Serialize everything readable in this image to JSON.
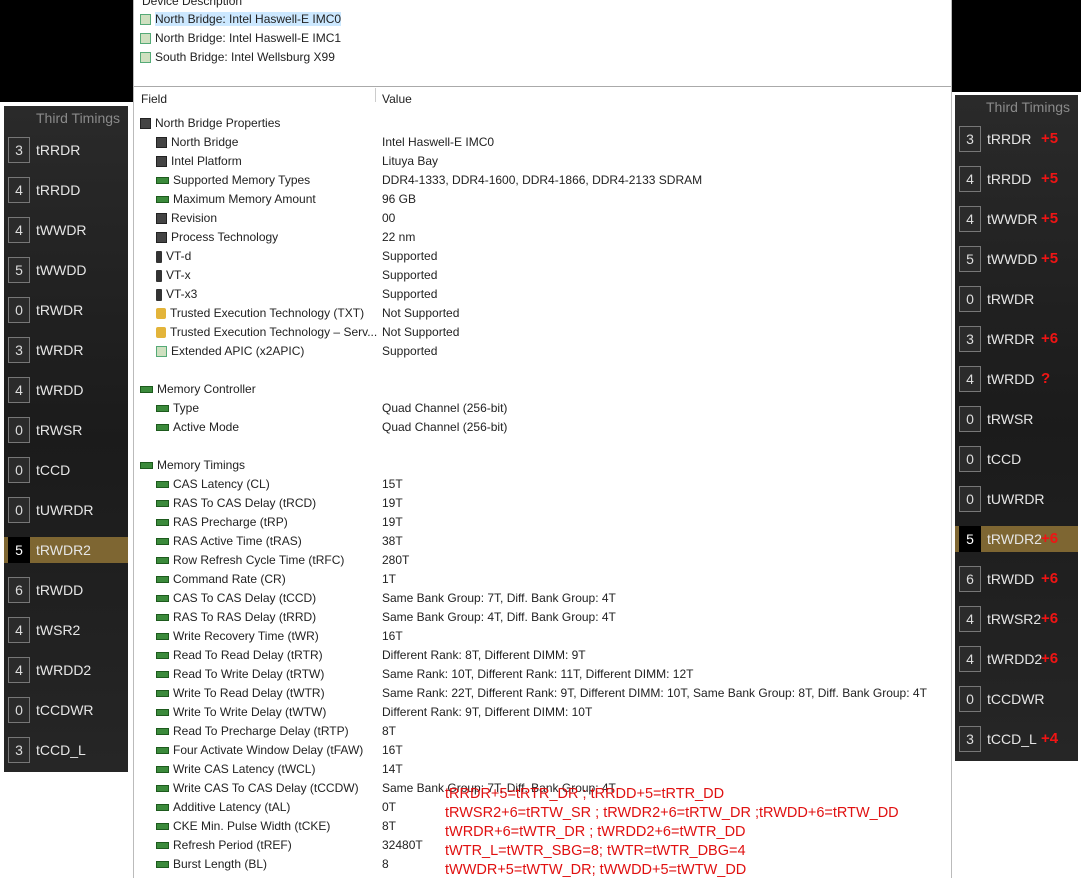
{
  "device_panel": {
    "header": "Device Description",
    "devices": [
      {
        "label": "North Bridge: Intel Haswell-E IMC0",
        "icon": "chip-icon",
        "selected": true
      },
      {
        "label": "North Bridge: Intel Haswell-E IMC1",
        "icon": "chip-icon",
        "selected": false
      },
      {
        "label": "South Bridge: Intel Wellsburg X99",
        "icon": "chip-icon",
        "selected": false
      }
    ]
  },
  "columns": {
    "field": "Field",
    "value": "Value"
  },
  "properties": [
    {
      "field": "North Bridge Properties",
      "value": "",
      "group": true,
      "icon": "chip-icon"
    },
    {
      "field": "North Bridge",
      "value": "Intel Haswell-E IMC0",
      "icon": "chip-icon"
    },
    {
      "field": "Intel Platform",
      "value": "Lituya Bay",
      "icon": "chip-icon"
    },
    {
      "field": "Supported Memory Types",
      "value": "DDR4-1333, DDR4-1600, DDR4-1866, DDR4-2133 SDRAM",
      "icon": "memory-icon"
    },
    {
      "field": "Maximum Memory Amount",
      "value": "96 GB",
      "icon": "memory-icon"
    },
    {
      "field": "Revision",
      "value": "00",
      "icon": "chip-icon"
    },
    {
      "field": "Process Technology",
      "value": "22 nm",
      "icon": "chip-icon"
    },
    {
      "field": "VT-d",
      "value": "Supported",
      "icon": "device-icon"
    },
    {
      "field": "VT-x",
      "value": "Supported",
      "icon": "device-icon"
    },
    {
      "field": "VT-x3",
      "value": "Supported",
      "icon": "device-icon"
    },
    {
      "field": "Trusted Execution Technology (TXT)",
      "value": "Not Supported",
      "icon": "lock-icon"
    },
    {
      "field": "Trusted Execution Technology – Serv...",
      "value": "Not Supported",
      "icon": "lock-icon"
    },
    {
      "field": "Extended APIC (x2APIC)",
      "value": "Supported",
      "icon": "apic-icon"
    },
    {
      "field": "",
      "value": "",
      "blank": true
    },
    {
      "field": "Memory Controller",
      "value": "",
      "group": true,
      "icon": "memory-icon"
    },
    {
      "field": "Type",
      "value": "Quad Channel  (256-bit)",
      "icon": "memory-icon"
    },
    {
      "field": "Active Mode",
      "value": "Quad Channel  (256-bit)",
      "icon": "memory-icon"
    },
    {
      "field": "",
      "value": "",
      "blank": true
    },
    {
      "field": "Memory Timings",
      "value": "",
      "group": true,
      "icon": "memory-icon"
    },
    {
      "field": "CAS Latency (CL)",
      "value": "15T",
      "icon": "memory-icon"
    },
    {
      "field": "RAS To CAS Delay (tRCD)",
      "value": "19T",
      "icon": "memory-icon"
    },
    {
      "field": "RAS Precharge (tRP)",
      "value": "19T",
      "icon": "memory-icon"
    },
    {
      "field": "RAS Active Time (tRAS)",
      "value": "38T",
      "icon": "memory-icon"
    },
    {
      "field": "Row Refresh Cycle Time (tRFC)",
      "value": "280T",
      "icon": "memory-icon"
    },
    {
      "field": "Command Rate (CR)",
      "value": "1T",
      "icon": "memory-icon"
    },
    {
      "field": "CAS To CAS Delay (tCCD)",
      "value": "Same Bank Group: 7T, Diff. Bank Group: 4T",
      "icon": "memory-icon"
    },
    {
      "field": "RAS To RAS Delay (tRRD)",
      "value": "Same Bank Group: 4T, Diff. Bank Group: 4T",
      "icon": "memory-icon"
    },
    {
      "field": "Write Recovery Time (tWR)",
      "value": "16T",
      "icon": "memory-icon"
    },
    {
      "field": "Read To Read Delay (tRTR)",
      "value": "Different Rank: 8T, Different DIMM: 9T",
      "icon": "memory-icon"
    },
    {
      "field": "Read To Write Delay (tRTW)",
      "value": "Same Rank: 10T, Different Rank: 11T, Different DIMM: 12T",
      "icon": "memory-icon"
    },
    {
      "field": "Write To Read Delay (tWTR)",
      "value": "Same Rank: 22T, Different Rank: 9T, Different DIMM: 10T, Same Bank Group: 8T, Diff. Bank Group: 4T",
      "icon": "memory-icon"
    },
    {
      "field": "Write To Write Delay (tWTW)",
      "value": "Different Rank: 9T, Different DIMM: 10T",
      "icon": "memory-icon"
    },
    {
      "field": "Read To Precharge Delay (tRTP)",
      "value": "8T",
      "icon": "memory-icon"
    },
    {
      "field": "Four Activate Window Delay (tFAW)",
      "value": "16T",
      "icon": "memory-icon"
    },
    {
      "field": "Write CAS Latency (tWCL)",
      "value": "14T",
      "icon": "memory-icon"
    },
    {
      "field": "Write CAS To CAS Delay (tCCDW)",
      "value": "Same Bank Group: 7T, Diff. Bank Group: 4T",
      "icon": "memory-icon"
    },
    {
      "field": "Additive Latency (tAL)",
      "value": "0T",
      "icon": "memory-icon"
    },
    {
      "field": "CKE Min. Pulse Width (tCKE)",
      "value": "8T",
      "icon": "memory-icon"
    },
    {
      "field": "Refresh Period (tREF)",
      "value": "32480T",
      "icon": "memory-icon"
    },
    {
      "field": "Burst Length (BL)",
      "value": "8",
      "icon": "memory-icon"
    }
  ],
  "left_timings": {
    "title": "Third Timings",
    "rows": [
      {
        "num": "3",
        "label": "tRRDR"
      },
      {
        "num": "4",
        "label": "tRRDD"
      },
      {
        "num": "4",
        "label": "tWWDR"
      },
      {
        "num": "5",
        "label": "tWWDD"
      },
      {
        "num": "0",
        "label": "tRWDR"
      },
      {
        "num": "3",
        "label": "tWRDR"
      },
      {
        "num": "4",
        "label": "tWRDD"
      },
      {
        "num": "0",
        "label": "tRWSR"
      },
      {
        "num": "0",
        "label": "tCCD"
      },
      {
        "num": "0",
        "label": "tUWRDR"
      },
      {
        "num": "5",
        "label": "tRWDR2",
        "highlight": true
      },
      {
        "num": "6",
        "label": "tRWDD"
      },
      {
        "num": "4",
        "label": "tWSR2"
      },
      {
        "num": "4",
        "label": "tWRDD2"
      },
      {
        "num": "0",
        "label": "tCCDWR"
      },
      {
        "num": "3",
        "label": "tCCD_L"
      }
    ]
  },
  "right_timings": {
    "title": "Third Timings",
    "rows": [
      {
        "num": "3",
        "label": "tRRDR",
        "delta": "+5"
      },
      {
        "num": "4",
        "label": "tRRDD",
        "delta": "+5"
      },
      {
        "num": "4",
        "label": "tWWDR",
        "delta": "+5"
      },
      {
        "num": "5",
        "label": "tWWDD",
        "delta": "+5"
      },
      {
        "num": "0",
        "label": "tRWDR",
        "delta": ""
      },
      {
        "num": "3",
        "label": "tWRDR",
        "delta": "+6"
      },
      {
        "num": "4",
        "label": "tWRDD",
        "delta": "?"
      },
      {
        "num": "0",
        "label": "tRWSR",
        "delta": ""
      },
      {
        "num": "0",
        "label": "tCCD",
        "delta": ""
      },
      {
        "num": "0",
        "label": "tUWRDR",
        "delta": ""
      },
      {
        "num": "5",
        "label": "tRWDR2",
        "delta": "+6",
        "highlight": true
      },
      {
        "num": "6",
        "label": "tRWDD",
        "delta": "+6"
      },
      {
        "num": "4",
        "label": "tRWSR2",
        "delta": "+6"
      },
      {
        "num": "4",
        "label": "tWRDD2",
        "delta": "+6"
      },
      {
        "num": "0",
        "label": "tCCDWR",
        "delta": ""
      },
      {
        "num": "3",
        "label": "tCCD_L",
        "delta": "+4"
      }
    ]
  },
  "annotations": [
    "tRRDR+5=tRTR_DR ; tRRDD+5=tRTR_DD",
    "tRWSR2+6=tRTW_SR ; tRWDR2+6=tRTW_DR ;tRWDD+6=tRTW_DD",
    "tWRDR+6=tWTR_DR ; tWRDD2+6=tWTR_DD",
    "tWTR_L=tWTR_SBG=8; tWTR=tWTR_DBG=4",
    "tWWDR+5=tWTW_DR; tWWDD+5=tWTW_DD"
  ],
  "colors": {
    "annotation": "#e01010",
    "highlight": "#7e6632",
    "panel": "#222222"
  }
}
